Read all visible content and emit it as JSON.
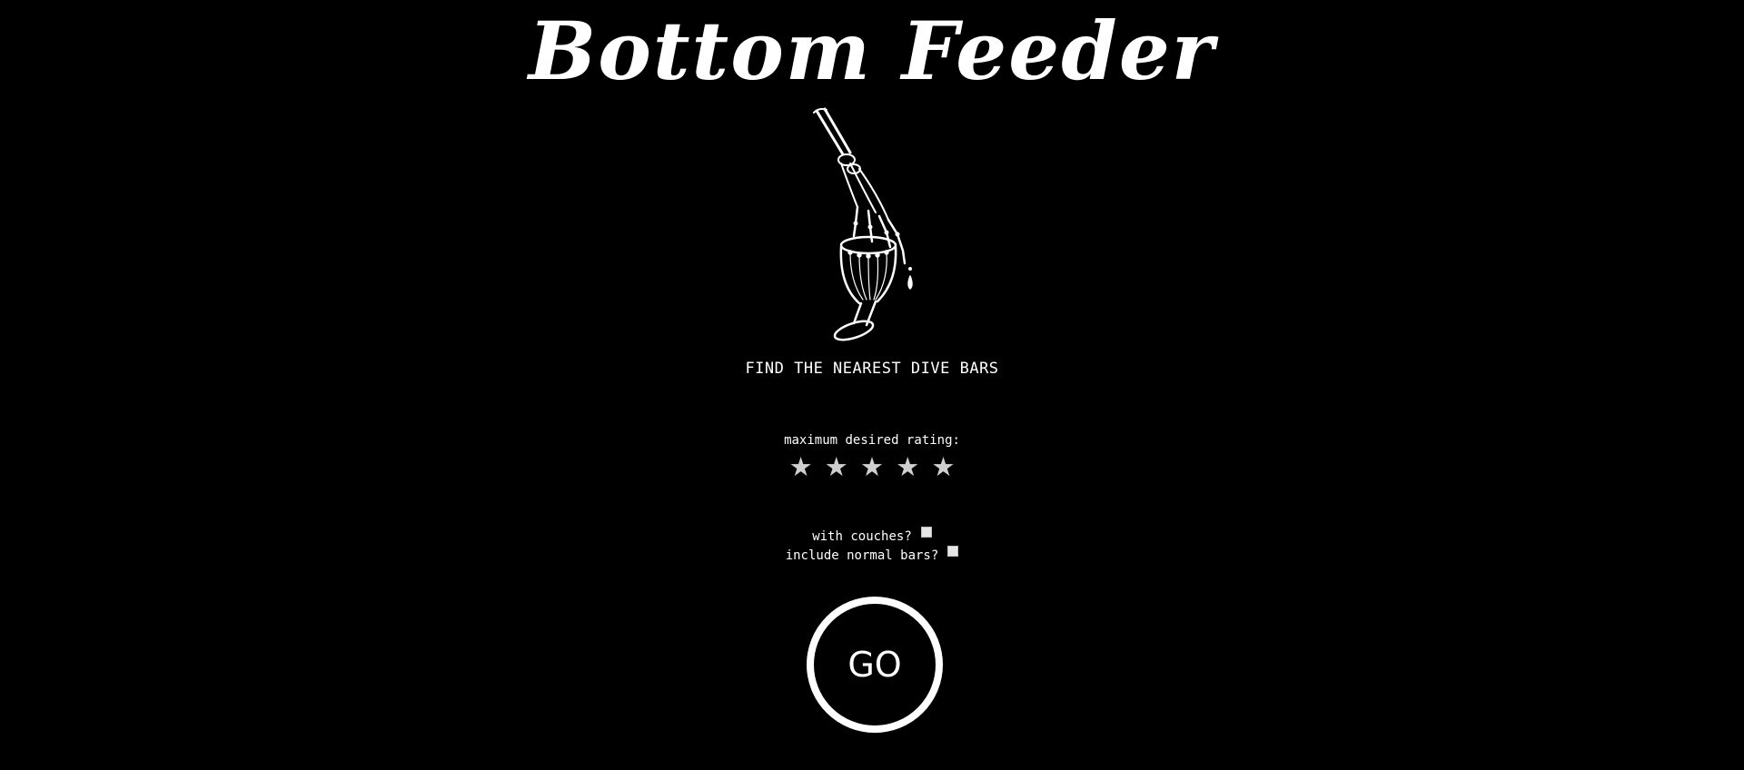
{
  "header": {
    "title": "Bottom Feeder"
  },
  "hero": {
    "illustration_icon": "skeleton-hand-goblet-icon"
  },
  "tagline": "FIND THE NEAREST DIVE BARS",
  "rating": {
    "label": "maximum desired rating:",
    "max_stars": 5,
    "star_glyph": "★",
    "star_color": "#cfcfcf"
  },
  "options": {
    "couches_label": "with couches?",
    "couches_checked": false,
    "normal_bars_label": "include normal bars?",
    "normal_bars_checked": false
  },
  "go_button": {
    "label": "GO"
  },
  "colors": {
    "background": "#000000",
    "foreground": "#ffffff"
  }
}
